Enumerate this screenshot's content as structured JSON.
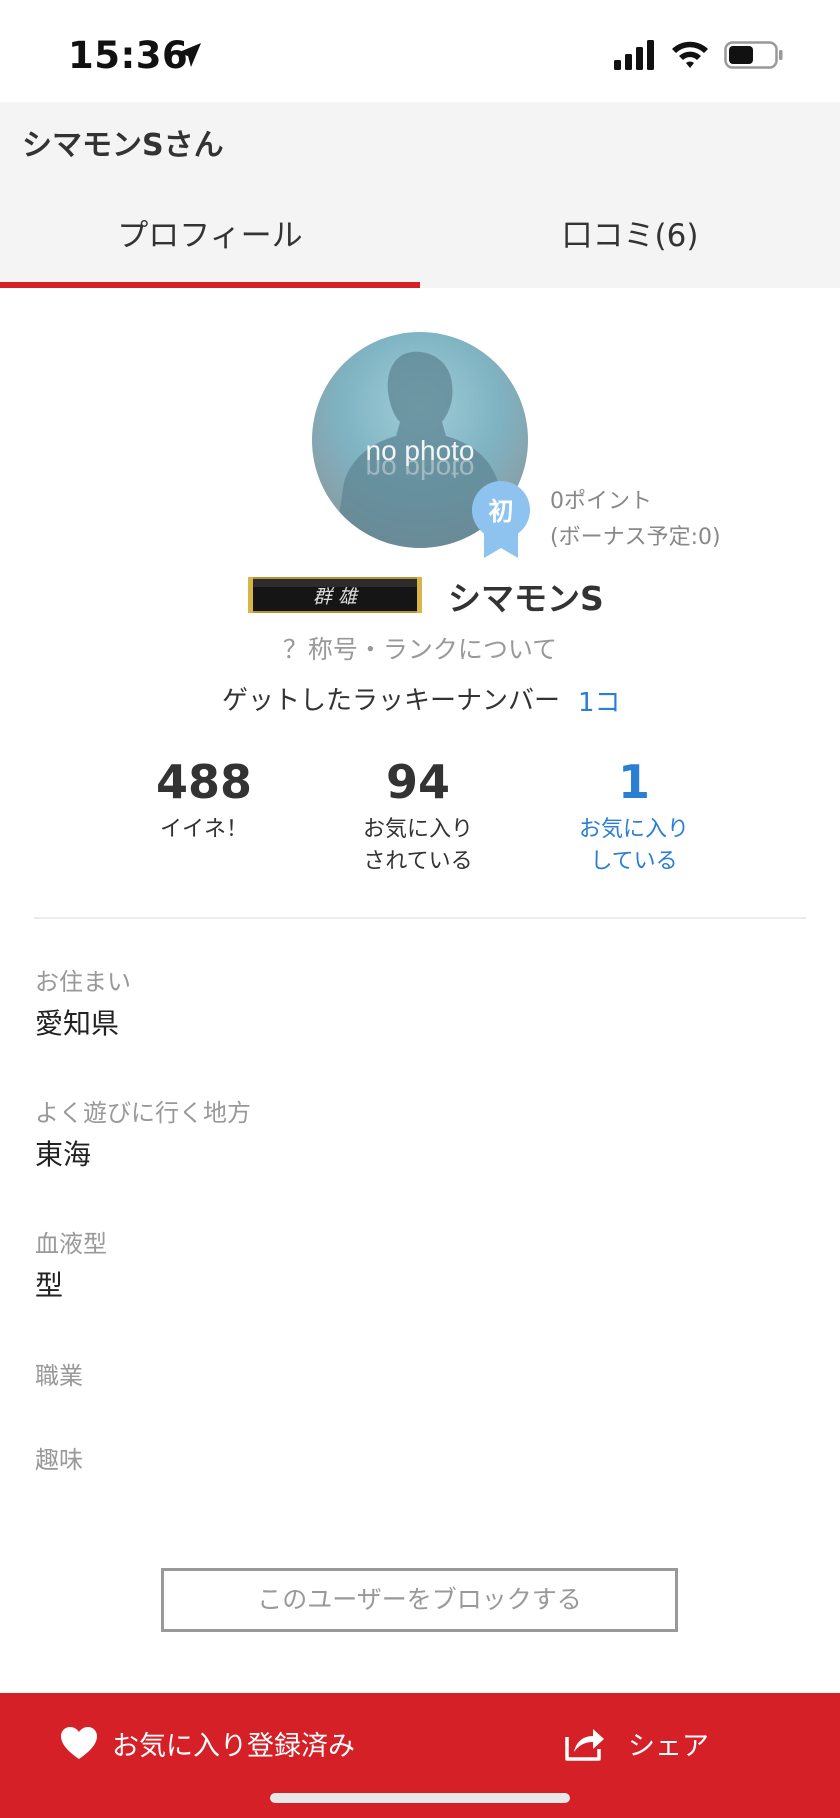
{
  "status_bar": {
    "time": "15:36"
  },
  "header": {
    "title": "シマモンSさん",
    "tabs": [
      {
        "label": "プロフィール",
        "active": true
      },
      {
        "label": "口コミ(6)",
        "active": false
      }
    ]
  },
  "profile": {
    "avatar_text": "no photo",
    "rank_badge": "初",
    "points": "0ポイント",
    "bonus": "(ボーナス予定:0)",
    "title_plate": "群 雄",
    "username": "シマモンS",
    "rank_link": "？称号・ランクについて",
    "lucky_label": "ゲットしたラッキーナンバー",
    "lucky_count": "1コ"
  },
  "stats": [
    {
      "value": "488",
      "label": "イイネ！"
    },
    {
      "value": "94",
      "label": "お気に入り\nされている"
    },
    {
      "value": "1",
      "label": "お気に入り\nしている"
    }
  ],
  "fields": [
    {
      "label": "お住まい",
      "value": "愛知県"
    },
    {
      "label": "よく遊びに行く地方",
      "value": "東海"
    },
    {
      "label": "血液型",
      "value": "型"
    },
    {
      "label": "職業",
      "value": ""
    },
    {
      "label": "趣味",
      "value": ""
    }
  ],
  "block_button": "このユーザーをブロックする",
  "bottom_bar": {
    "favorite_label": "お気に入り登録済み",
    "share_label": "シェア"
  },
  "colors": {
    "accent": "#d42026",
    "link": "#2a7fd4",
    "badge": "#8ec3ef"
  }
}
